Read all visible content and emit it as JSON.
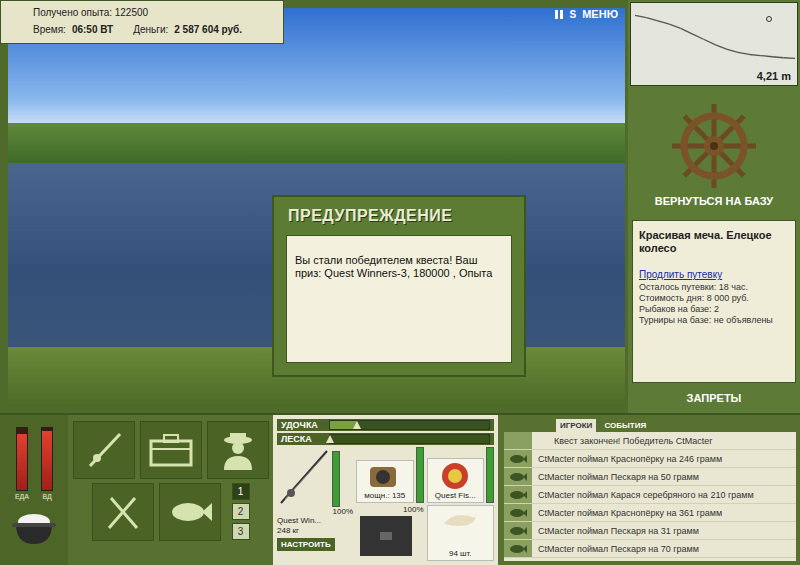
{
  "hud": {
    "experience": "Получено опыта: 122500",
    "time_label": "Время:",
    "time": "06:50 ВТ",
    "money_label": "Деньги:",
    "money": "2 587 604 руб."
  },
  "top_controls": {
    "sound": "S",
    "menu": "МЕНЮ"
  },
  "depth_chart": {
    "reading": "4,21 m",
    "values": [
      0.4,
      0.6,
      0.9,
      1.2,
      1.6,
      2.1,
      2.6,
      3.1,
      3.5,
      3.8,
      4.0,
      4.1,
      4.21,
      4.3,
      4.35
    ]
  },
  "base": {
    "button": "ВЕРНУТЬСЯ НА БАЗУ",
    "location": "Красивая меча. Елецкое колесо",
    "extend_link": "Продлить путевку",
    "details": [
      "Осталось путевки: 18 час.",
      "Стоимость дня: 8 000 руб.",
      "Рыбаков на базе: 2",
      "Турниры на базе: не объявлены"
    ],
    "bans_button": "ЗАПРЕТЫ"
  },
  "dialog": {
    "title": "ПРЕДУПРЕЖДЕНИЕ",
    "message": "Вы стали победителем квеста! Ваш приз: Quest Winners-3, 180000 , Опыта"
  },
  "gauges": [
    {
      "label": "ЕДА",
      "level": 0.9
    },
    {
      "label": "ВД",
      "level": 0.95
    }
  ],
  "slots": [
    {
      "label": "1",
      "selected": true
    },
    {
      "label": "2",
      "selected": false
    },
    {
      "label": "3",
      "selected": false
    }
  ],
  "tension": [
    {
      "label": "УДОЧКА",
      "level": 0.17
    },
    {
      "label": "ЛЕСКА",
      "level": 0.0
    }
  ],
  "tackle": {
    "rod": {
      "name": "Quest Win...",
      "weight": "248 кг",
      "durability": "100%",
      "level": 1.0
    },
    "setup_button": "НАСТРОИТЬ",
    "reel": {
      "power": "мощн.: 135",
      "durability": "100%",
      "level": 1.0
    },
    "line": {
      "name": "Quest Fis...",
      "level": 1.0
    },
    "bait": {
      "count": "94 шт."
    }
  },
  "events_panel": {
    "tabs": [
      {
        "label": "ИГРОКИ",
        "selected": true
      },
      {
        "label": "СОБЫТИЯ",
        "selected": false
      }
    ],
    "items": [
      {
        "text": "Квест закончен! Победитель CtMacter",
        "kind": "notice"
      },
      {
        "text": "CtMacter поймал Краснопёрку на 246 грамм",
        "kind": "catch"
      },
      {
        "text": "CtMacter поймал Пескаря на 50 грамм",
        "kind": "catch"
      },
      {
        "text": "CtMacter поймал Карася серебряного на 210 грамм",
        "kind": "catch"
      },
      {
        "text": "CtMacter поймал Краснопёрку на 361 грамм",
        "kind": "catch"
      },
      {
        "text": "CtMacter поймал Пескаря на 31 грамм",
        "kind": "catch"
      },
      {
        "text": "CtMacter поймал Пескаря на 70 грамм",
        "kind": "catch"
      }
    ]
  }
}
